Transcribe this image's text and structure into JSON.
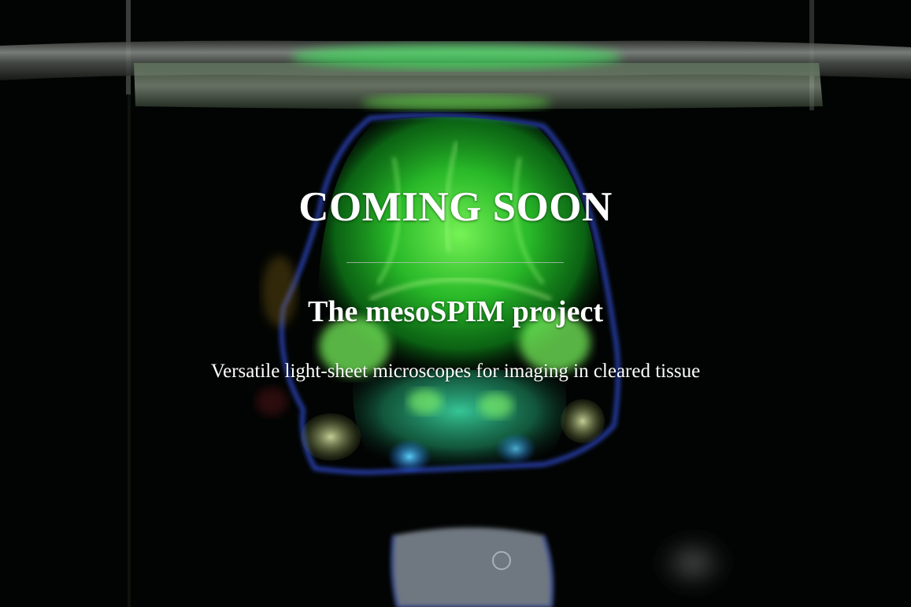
{
  "hero": {
    "headline": "COMING SOON",
    "subheading": "The mesoSPIM project",
    "tagline": "Versatile light-sheet microscopes for imaging in cleared tissue"
  },
  "background": {
    "icon": "cleared-mouse-brain-fluorescence-photo",
    "colors": {
      "base": "#020403",
      "fluorescence_green": "#3df03a",
      "edge_blue": "#3a5cff",
      "text": "#ffffff"
    }
  }
}
